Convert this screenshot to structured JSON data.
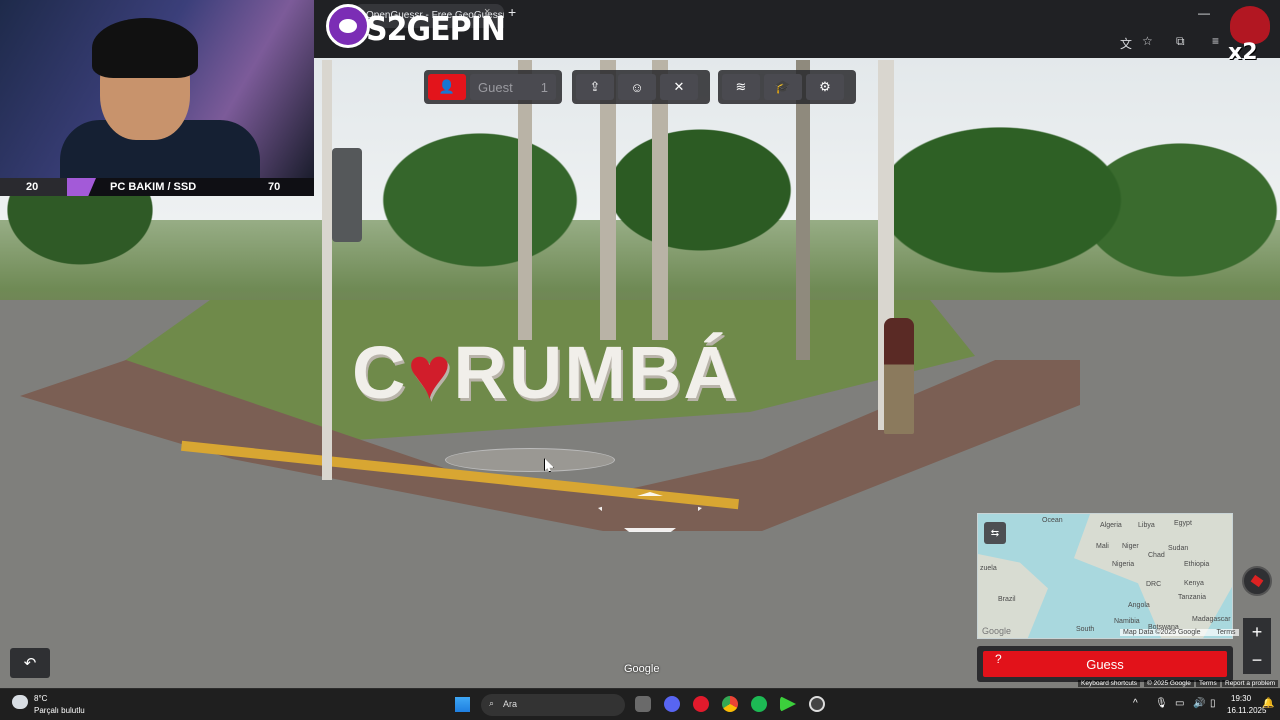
{
  "browser": {
    "tab_title": "OpenGuessr - Free GeoGuessr",
    "tab_close": "×",
    "new_tab": "+"
  },
  "site": {
    "logo_text": "S2GEPIN"
  },
  "stream_overlay": {
    "left_counter": "20",
    "label": "PC BAKIM / SSD",
    "right_counter": "70",
    "multiplier": "x2"
  },
  "toolbar": {
    "guest_label": "Guest",
    "guest_count": "1",
    "icons": [
      "add-player-icon",
      "upload-icon",
      "party-icon",
      "close-cross-icon",
      "layers-icon",
      "education-icon",
      "settings-gear-icon"
    ]
  },
  "scene": {
    "sign_text_before": "C",
    "sign_heart": "♥",
    "sign_text_after": "RUMBÁ",
    "google_watermark": "Google"
  },
  "minimap": {
    "labels": [
      "Ocean",
      "Algeria",
      "Libya",
      "Egypt",
      "Mali",
      "Niger",
      "Sudan",
      "Chad",
      "Nigeria",
      "Ethiopia",
      "DRC",
      "Kenya",
      "Tanzania",
      "Angola",
      "Brazil",
      "Namibia",
      "Botswana",
      "Madagascar",
      "South",
      "zuela"
    ],
    "attribution": "Map Data ©2025 Google",
    "terms": "Terms",
    "google_logo": "Google"
  },
  "guess_button": {
    "label": "Guess",
    "help": "?"
  },
  "bottom_attribution": {
    "keyboard": "Keyboard shortcuts",
    "map_data": "© 2025 Google",
    "terms": "Terms",
    "report": "Report a problem"
  },
  "taskbar": {
    "weather_temp": "8°C",
    "weather_desc": "Parçalı bulutlu",
    "search_placeholder": "Ara",
    "time": "19:30",
    "date": "16.11.2025"
  }
}
